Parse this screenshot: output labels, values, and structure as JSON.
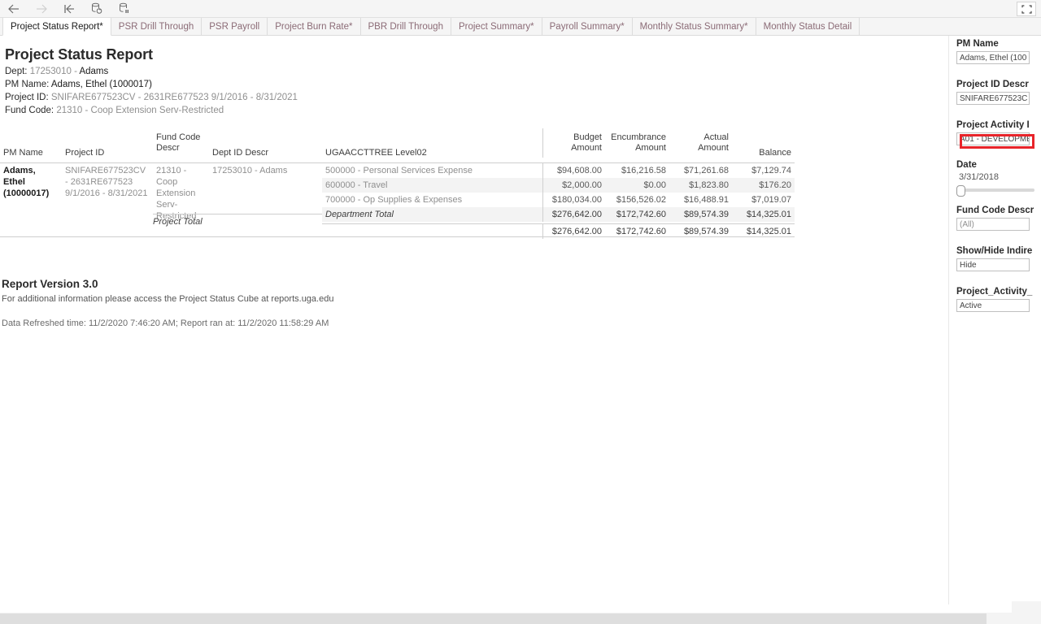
{
  "toolbar": {
    "buttons": [
      {
        "name": "back-button",
        "icon": "arrow-left-icon",
        "enabled": true
      },
      {
        "name": "forward-button",
        "icon": "arrow-right-icon",
        "enabled": false
      },
      {
        "name": "revert-button",
        "icon": "revert-to-start-icon",
        "enabled": true
      },
      {
        "name": "refresh-button",
        "icon": "refresh-data-source-icon",
        "enabled": true
      },
      {
        "name": "pause-button",
        "icon": "pause-auto-update-icon",
        "enabled": true
      }
    ],
    "fullscreen_icon": "fullscreen-icon"
  },
  "tabs": [
    {
      "label": "Project Status Report*",
      "active": true
    },
    {
      "label": "PSR Drill Through",
      "active": false
    },
    {
      "label": "PSR Payroll",
      "active": false
    },
    {
      "label": "Project Burn Rate*",
      "active": false
    },
    {
      "label": "PBR Drill Through",
      "active": false
    },
    {
      "label": "Project Summary*",
      "active": false
    },
    {
      "label": "Payroll Summary*",
      "active": false
    },
    {
      "label": "Monthly Status Summary*",
      "active": false
    },
    {
      "label": "Monthly Status Detail",
      "active": false
    }
  ],
  "report": {
    "title": "Project Status Report",
    "dept_label": "Dept:",
    "dept_value": "17253010 -",
    "dept_name": "Adams",
    "pm_label": "PM Name:",
    "pm_value": "Adams, Ethel (1000017)",
    "project_label": "Project ID:",
    "project_value": "SNIFARE677523CV - 2631RE677523 9/1/2016 - 8/31/2021",
    "fund_label": "Fund Code:",
    "fund_value": "21310 - Coop Extension Serv-Restricted"
  },
  "table": {
    "headers": {
      "pm_name": "PM Name",
      "project_id": "Project ID",
      "fund_code_descr": "Fund Code Descr",
      "dept_id_descr": "Dept ID Descr",
      "ugaaccttree": "UGAACCTTREE Level02",
      "budget_amount": "Budget Amount",
      "encumbrance_amount": "Encumbrance Amount",
      "actual_amount": "Actual Amount",
      "balance": "Balance"
    },
    "left_block": {
      "pm_name": "Adams, Ethel (10000017)",
      "project_id": "SNIFARE677523CV - 2631RE677523 9/1/2016 - 8/31/2021",
      "fund_code_descr": "21310 - Coop Extension Serv-Restricted",
      "dept_id_descr": "17253010 - Adams"
    },
    "rows": [
      {
        "account": "500000 - Personal Services Expense",
        "budget": "$94,608.00",
        "encumbrance": "$16,216.58",
        "actual": "$71,261.68",
        "balance": "$7,129.74",
        "shaded": false
      },
      {
        "account": "600000 - Travel",
        "budget": "$2,000.00",
        "encumbrance": "$0.00",
        "actual": "$1,823.80",
        "balance": "$176.20",
        "shaded": true
      },
      {
        "account": "700000 - Op Supplies & Expenses",
        "budget": "$180,034.00",
        "encumbrance": "$156,526.02",
        "actual": "$16,488.91",
        "balance": "$7,019.07",
        "shaded": false
      },
      {
        "account": "Department Total",
        "budget": "$276,642.00",
        "encumbrance": "$172,742.60",
        "actual": "$89,574.39",
        "balance": "$14,325.01",
        "shaded": true
      }
    ],
    "project_total": {
      "label": "Project Total",
      "account": "",
      "budget": "$276,642.00",
      "encumbrance": "$172,742.60",
      "actual": "$89,574.39",
      "balance": "$14,325.01"
    }
  },
  "footer": {
    "version": "Report Version 3.0",
    "info": "For additional information please access the Project Status Cube at reports.uga.edu",
    "timestamps": "Data Refreshed time: 11/2/2020 7:46:20 AM; Report ran at: 11/2/2020 11:58:29 AM"
  },
  "filters": [
    {
      "name": "pm-name",
      "label": "PM Name",
      "value": "Adams, Ethel (100",
      "highlighted": false
    },
    {
      "name": "project-id-descr",
      "label": "Project ID Descr",
      "value": "SNIFARE677523C",
      "highlighted": false
    },
    {
      "name": "project-activity-id",
      "label": "Project Activity I",
      "value": "A01 - DEVELOPME",
      "highlighted": true
    },
    {
      "name": "fund-code-descr",
      "label": "Fund Code Descr",
      "value": "(All)",
      "highlighted": false
    },
    {
      "name": "show-hide-indirect",
      "label": "Show/Hide Indire",
      "value": "Hide",
      "highlighted": false
    },
    {
      "name": "project-activity-status",
      "label": "Project_Activity_",
      "value": "Active",
      "highlighted": false
    }
  ],
  "date_filter": {
    "label": "Date",
    "value": "3/31/2018",
    "slider_position": 0
  },
  "colors": {
    "highlight_red": "#e8242a",
    "tab_text": "#8b6b76",
    "accent_grey": "#8f8f8f"
  }
}
